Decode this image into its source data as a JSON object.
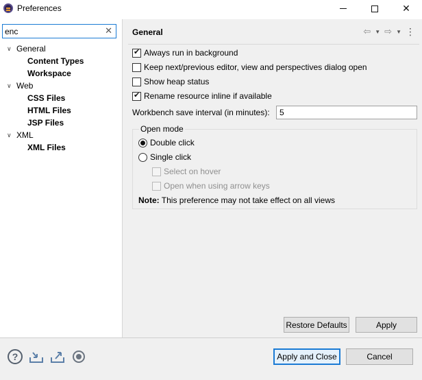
{
  "window": {
    "title": "Preferences",
    "minimize_icon": "minimize-icon",
    "maximize_icon": "maximize-icon",
    "close_icon": "close-icon"
  },
  "filter": {
    "value": "enc",
    "clear_glyph": "✕"
  },
  "tree": [
    {
      "label": "General",
      "expanded": true,
      "children": [
        "Content Types",
        "Workspace"
      ]
    },
    {
      "label": "Web",
      "expanded": true,
      "children": [
        "CSS Files",
        "HTML Files",
        "JSP Files"
      ]
    },
    {
      "label": "XML",
      "expanded": true,
      "children": [
        "XML Files"
      ]
    }
  ],
  "page": {
    "title": "General",
    "options": [
      {
        "label": "Always run in background",
        "checked": true
      },
      {
        "label": "Keep next/previous editor, view and perspectives dialog open",
        "checked": false
      },
      {
        "label": "Show heap status",
        "checked": false
      },
      {
        "label": "Rename resource inline if available",
        "checked": true
      }
    ],
    "interval_label": "Workbench save interval (in minutes):",
    "interval_value": "5",
    "open_mode": {
      "title": "Open mode",
      "double_click": "Double click",
      "single_click": "Single click",
      "selected": "double_click",
      "select_on_hover": "Select on hover",
      "open_arrow_keys": "Open when using arrow keys",
      "note_bold": "Note:",
      "note_text": " This preference may not take effect on all views"
    },
    "restore_defaults": "Restore Defaults",
    "apply": "Apply"
  },
  "footer": {
    "apply_and_close": "Apply and Close",
    "cancel": "Cancel",
    "icons": [
      "help-icon",
      "import-icon",
      "export-icon",
      "record-icon"
    ]
  },
  "colors": {
    "accent": "#1a7ad4",
    "panel_bg": "#f0f0f0"
  }
}
